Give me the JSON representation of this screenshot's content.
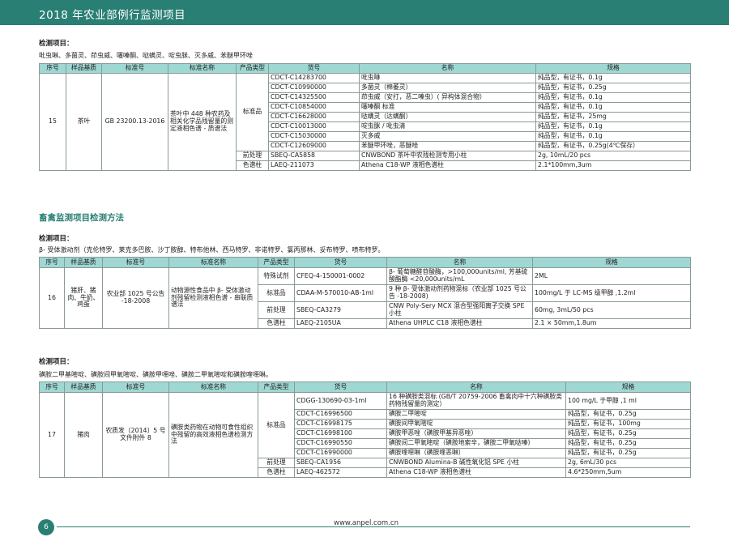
{
  "header": {
    "title": "2018 年农业部例行监测项目"
  },
  "columns": [
    "序号",
    "样品基质",
    "标准号",
    "标准名称",
    "产品类型",
    "货号",
    "名称",
    "规格"
  ],
  "label_text": "检测项目：",
  "section2_title": "畜禽监测项目检测方法",
  "block1": {
    "items": "吡虫啉、多菌灵、茚虫威、噻嗪酮、哒螨灵、啶虫脒、灭多威、苯醚甲环唑",
    "seq": "15",
    "matrix": "茶叶",
    "std_no": "GB 23200.13-2016",
    "std_name": "茶叶中 448 种农药及相关化学品残留量的测定液相色谱 - 质谱法",
    "rows": [
      {
        "type": "标准品",
        "cat": "CDCT-C14283700",
        "name": "吡虫啉",
        "spec": "纯品型，有证书，0.1g"
      },
      {
        "type": "",
        "cat": "CDCT-C10990000",
        "name": "多菌灵（棉萎灵）",
        "spec": "纯品型，有证书，0.25g"
      },
      {
        "type": "",
        "cat": "CDCT-C14325500",
        "name": "茚虫威（安打，恶二嗪虫）( 异构体混合物）",
        "spec": "纯品型，有证书，0.1g"
      },
      {
        "type": "",
        "cat": "CDCT-C10854000",
        "name": "噻嗪酮 标准",
        "spec": "纯品型，有证书，0.1g"
      },
      {
        "type": "",
        "cat": "CDCT-C16628000",
        "name": "哒螨灵（达螨酮）",
        "spec": "纯品型，有证书，25mg"
      },
      {
        "type": "",
        "cat": "CDCT-C10013000",
        "name": "啶虫脒 / 吡虫清",
        "spec": "纯品型，有证书，0.1g"
      },
      {
        "type": "",
        "cat": "CDCT-C15030000",
        "name": "灭多威",
        "spec": "纯品型，有证书，0.1g"
      },
      {
        "type": "",
        "cat": "CDCT-C12609000",
        "name": "苯醚甲环唑，恶醚唑",
        "spec": "纯品型，有证书，0.25g(4℃保存）"
      },
      {
        "type": "前处理",
        "cat": "SBEQ-CA5858",
        "name": "CNWBOND 茶叶中农残检测专用小柱",
        "spec": "2g, 10mL/20 pcs"
      },
      {
        "type": "色谱柱",
        "cat": "LAEQ-211073",
        "name": "Athena C18-WP 液相色谱柱",
        "spec": "2.1*100mm,3um"
      }
    ]
  },
  "block2": {
    "items": "β- 受体激动剂（克伦特罗、莱克多巴胺、沙丁胺醇、特布他林、西马特罗、非诺特罗、氯丙那林、妥布特罗、喷布特罗。",
    "seq": "16",
    "matrix": "猪肝、猪肉、牛奶、鸡蛋",
    "std_no": "农业部 1025 号公告 -18-2008",
    "std_name": "动物源性食品中 β- 受体激动剂残留检测液相色谱 - 串联质谱法",
    "rows": [
      {
        "type": "特殊试剂",
        "cat": "CFEQ-4-150001-0002",
        "name": "β- 葡萄糖醛苷酸酶，>100,000units/ml, 芳基硫酸酯酶 <20,000units/mL",
        "spec": "2ML"
      },
      {
        "type": "标准品",
        "cat": "CDAA-M-570010-AB-1ml",
        "name": "9 种 β- 受体激动剂药物混标（农业部 1025 号公告 -18-2008)",
        "spec": "100mg/L 于 LC-MS 级甲醇 ,1.2ml"
      },
      {
        "type": "前处理",
        "cat": "SBEQ-CA3279",
        "name": "CNW Poly-Sery MCX 混合型强阳离子交换 SPE 小柱",
        "spec": "60mg, 3mL/50 pcs"
      },
      {
        "type": "色谱柱",
        "cat": "LAEQ-2105UA",
        "name": "Athena UHPLC C18 液相色谱柱",
        "spec": "2.1 × 50mm,1.8um"
      }
    ]
  },
  "block3": {
    "items": "磺胺二甲基嘧啶、磺胺间甲氧嘧啶、磺胺甲噁唑、磺胺二甲氧嘧啶和磺胺喹噁啉。",
    "seq": "17",
    "matrix": "猪肉",
    "std_no": "农质发〔2014〕5 号文件附件 8",
    "std_name": "磺胺类药物在动物可食性组织中残留的高效液相色谱检测方法",
    "rows": [
      {
        "type": "标准品",
        "cat": "CDGG-130690-03-1ml",
        "name": "16 种磺胺类混标 (GB/T 20759-2006 畜禽肉中十六种磺胺类药物残留量的测定）",
        "spec": "100 mg/L 于甲醇 ,1 ml"
      },
      {
        "type": "",
        "cat": "CDCT-C16996500",
        "name": "磺胺二甲嘧啶",
        "spec": "纯品型，有证书，0.25g"
      },
      {
        "type": "",
        "cat": "CDCT-C16998175",
        "name": "磺胺间甲氧嘧啶",
        "spec": "纯品型，有证书，100mg"
      },
      {
        "type": "",
        "cat": "CDCT-C16998100",
        "name": "磺胺甲恶唑（磺胺甲基异恶唑）",
        "spec": "纯品型，有证书，0.25g"
      },
      {
        "type": "",
        "cat": "CDCT-C16990550",
        "name": "磺胺间二甲氧嘧啶（磺胺地索辛，磺胺二甲氧哒嗪）",
        "spec": "纯品型，有证书，0.25g"
      },
      {
        "type": "",
        "cat": "CDCT-C16990000",
        "name": "磺胺喹噁啉（磺胺喹恶啉）",
        "spec": "纯品型，有证书，0.25g"
      },
      {
        "type": "前处理",
        "cat": "SBEQ-CA1956",
        "name": "CNWBOND Alumina-B 碱性氧化铝 SPE 小柱",
        "spec": "2g, 6mL/30 pcs"
      },
      {
        "type": "色谱柱",
        "cat": "LAEQ-462572",
        "name": "Athena C18-WP 液相色谱柱",
        "spec": "4.6*250mm,5um"
      }
    ]
  },
  "footer": {
    "page": "6",
    "site": "www.anpel.com.cn"
  }
}
